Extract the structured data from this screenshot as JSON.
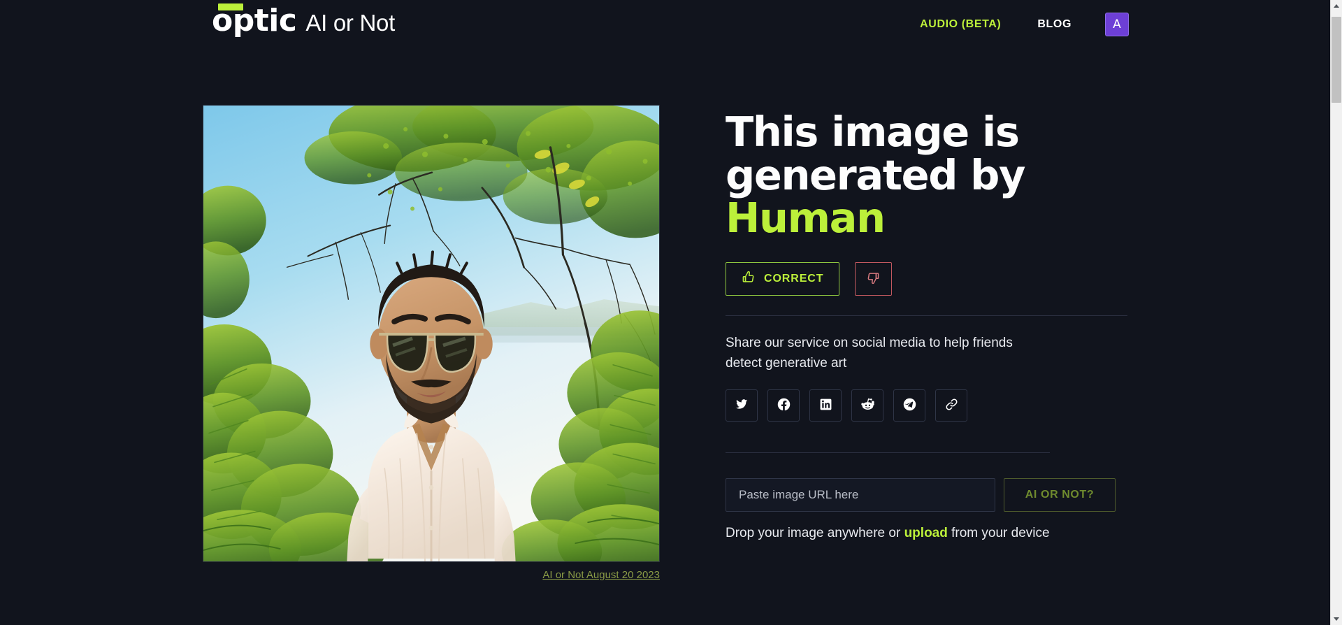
{
  "header": {
    "logo_word": "optic",
    "brand_sub": "AI or Not",
    "nav": {
      "audio_label": "AUDIO (BETA)",
      "blog_label": "BLOG",
      "avatar_initial": "A"
    }
  },
  "image_panel": {
    "caption": "AI or Not August 20 2023",
    "alt_description": "Photograph of a bearded man wearing sunglasses and an open white linen shirt, standing outdoors with green trees and blue sky behind him"
  },
  "result": {
    "headline_prefix": "This image is generated by",
    "verdict": "Human",
    "correct_label": "CORRECT",
    "thumbs_up_icon": "thumbs-up-icon",
    "thumbs_down_icon": "thumbs-down-icon"
  },
  "share": {
    "text": "Share our service on social media to help friends detect generative art",
    "networks": [
      {
        "name": "twitter",
        "icon": "twitter-icon"
      },
      {
        "name": "facebook",
        "icon": "facebook-icon"
      },
      {
        "name": "linkedin",
        "icon": "linkedin-icon"
      },
      {
        "name": "reddit",
        "icon": "reddit-icon"
      },
      {
        "name": "telegram",
        "icon": "telegram-icon"
      },
      {
        "name": "copylink",
        "icon": "link-icon"
      }
    ]
  },
  "upload": {
    "url_placeholder": "Paste image URL here",
    "url_value": "",
    "submit_label": "AI OR NOT?",
    "drop_prefix": "Drop your image anywhere or ",
    "drop_link": "upload",
    "drop_suffix": " from your device"
  },
  "colors": {
    "background": "#11141d",
    "accent_lime": "#bcf03a",
    "avatar_purple": "#6d3fd6",
    "negative_red": "#c2585f",
    "caption_olive": "#8a9b46",
    "disabled_green": "#6f8b2e"
  }
}
